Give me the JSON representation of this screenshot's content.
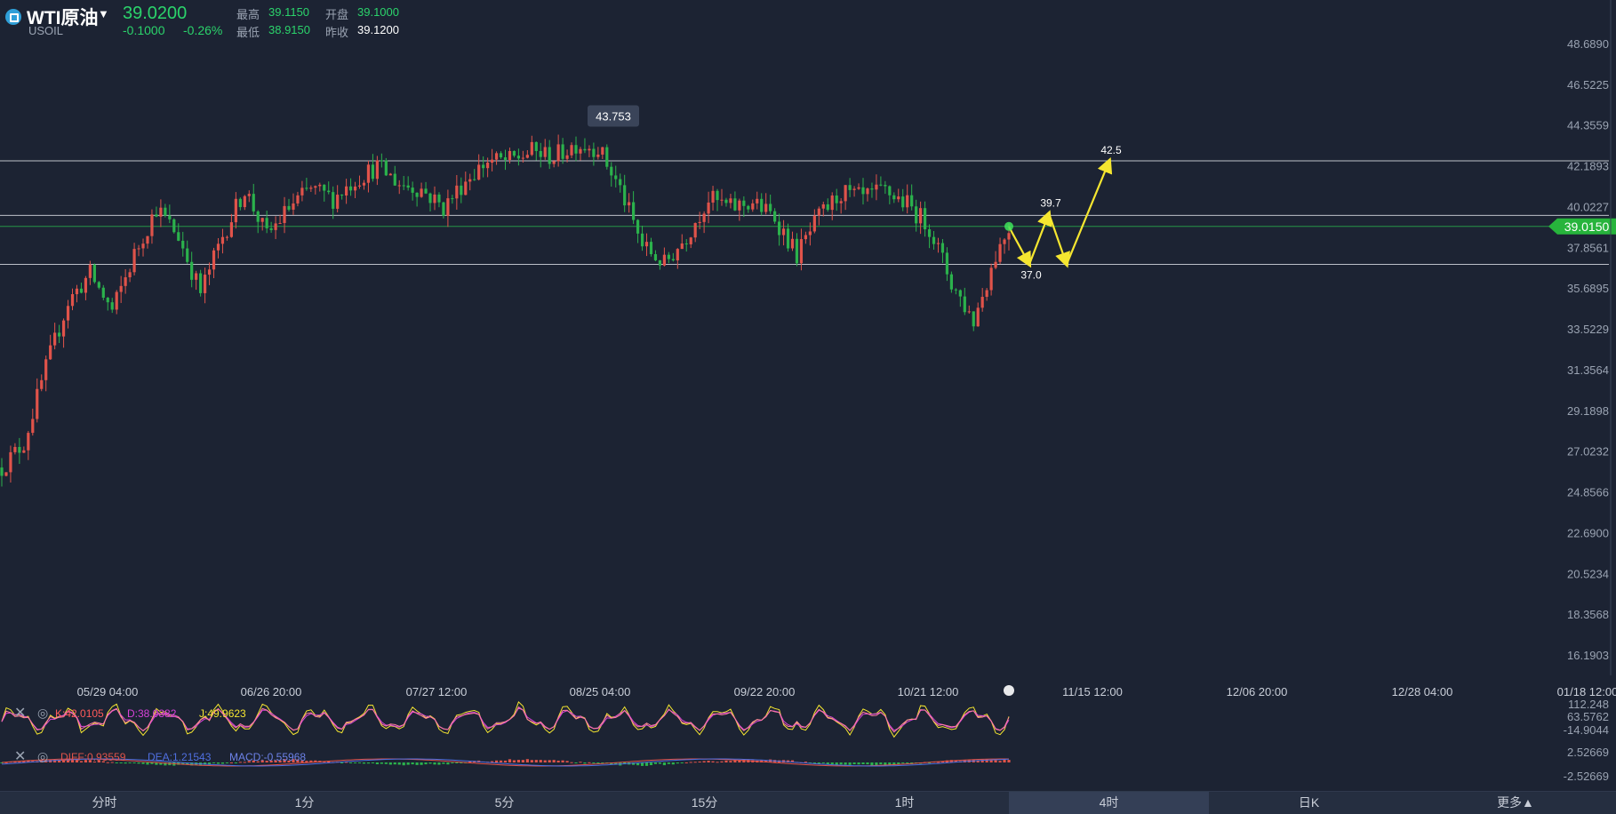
{
  "header": {
    "symbol_name": "WTI原油",
    "symbol_code": "USOIL",
    "last_price": "39.0200",
    "change": "-0.1000",
    "change_pct": "-0.26%",
    "high_label": "最高",
    "high_value": "39.1150",
    "open_label": "开盘",
    "open_value": "39.1000",
    "low_label": "最低",
    "low_value": "38.9150",
    "prev_close_label": "昨收",
    "prev_close_value": "39.1200"
  },
  "chart_data": {
    "type": "candlestick",
    "y_ticks": [
      "48.6890",
      "46.5225",
      "44.3559",
      "42.1893",
      "40.0227",
      "37.8561",
      "35.6895",
      "33.5229",
      "31.3564",
      "29.1898",
      "27.0232",
      "24.8566",
      "22.6900",
      "20.5234",
      "18.3568",
      "16.1903"
    ],
    "ylim": [
      16.1903,
      48.689
    ],
    "x_ticks": [
      "05/29 04:00",
      "06/26 20:00",
      "07/27 12:00",
      "08/25 04:00",
      "09/22 20:00",
      "10/21 12:00",
      "11/15 12:00",
      "12/06 20:00",
      "12/28 04:00",
      "01/18 12:00"
    ],
    "current_price_label": "39.0150",
    "current_price": 39.015,
    "peak_label": "43.753",
    "peak_value": 43.753,
    "horizontal_levels": [
      42.5,
      39.6,
      37.0
    ],
    "price_path": [
      [
        0,
        26.2
      ],
      [
        5,
        27.5
      ],
      [
        10,
        31.5
      ],
      [
        15,
        35.0
      ],
      [
        20,
        36.5
      ],
      [
        25,
        34.5
      ],
      [
        30,
        37.5
      ],
      [
        35,
        40.0
      ],
      [
        40,
        38.5
      ],
      [
        45,
        35.5
      ],
      [
        50,
        38.5
      ],
      [
        55,
        41.0
      ],
      [
        60,
        38.5
      ],
      [
        65,
        40.0
      ],
      [
        70,
        41.0
      ],
      [
        75,
        40.5
      ],
      [
        80,
        41.5
      ],
      [
        85,
        42.2
      ],
      [
        90,
        41.3
      ],
      [
        95,
        41.0
      ],
      [
        100,
        40.0
      ],
      [
        105,
        41.5
      ],
      [
        110,
        42.5
      ],
      [
        115,
        42.5
      ],
      [
        120,
        43.0
      ],
      [
        125,
        42.7
      ],
      [
        130,
        43.4
      ],
      [
        135,
        43.2
      ],
      [
        140,
        41.0
      ],
      [
        145,
        38.0
      ],
      [
        150,
        37.0
      ],
      [
        155,
        38.5
      ],
      [
        160,
        40.5
      ],
      [
        165,
        40.0
      ],
      [
        170,
        40.3
      ],
      [
        175,
        39.5
      ],
      [
        180,
        37.5
      ],
      [
        185,
        39.5
      ],
      [
        190,
        40.8
      ],
      [
        195,
        40.5
      ],
      [
        200,
        40.9
      ],
      [
        205,
        40.2
      ],
      [
        210,
        39.0
      ],
      [
        215,
        36.0
      ],
      [
        220,
        34.0
      ],
      [
        225,
        37.5
      ],
      [
        228,
        39.0
      ]
    ],
    "forecast_path": [
      {
        "value": 39.0,
        "label": ""
      },
      {
        "value": 37.0,
        "label": "37.0"
      },
      {
        "value": 39.7,
        "label": "39.7"
      },
      {
        "value": 37.0,
        "label": ""
      },
      {
        "value": 42.5,
        "label": "42.5"
      }
    ],
    "kdj": {
      "K_label": "K:42.0105",
      "D_label": "D:38.0382",
      "J_label": "J:49.9623",
      "y_ticks": [
        "112.248",
        "63.5762",
        "-14.9044"
      ]
    },
    "macd": {
      "DIFF_label": "DIFF:0.93559",
      "DEA_label": "DEA:1.21543",
      "MACD_label": "MACD:-0.55968",
      "y_ticks": [
        "2.52669",
        "-2.52669"
      ]
    }
  },
  "colors": {
    "up": "#e0534a",
    "down": "#2bb24c",
    "bg": "#1c2333",
    "forecast": "#f5e630",
    "price_tag": "#27b43c"
  },
  "tabs": [
    {
      "label": "分时"
    },
    {
      "label": "1分"
    },
    {
      "label": "5分"
    },
    {
      "label": "15分"
    },
    {
      "label": "1时"
    },
    {
      "label": "4时"
    },
    {
      "label": "日K"
    },
    {
      "label": "更多▲"
    }
  ],
  "active_tab": "4时"
}
